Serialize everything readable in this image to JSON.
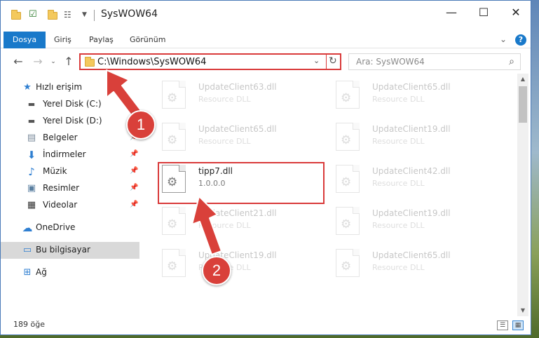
{
  "window": {
    "title": "SysWOW64",
    "controls": {
      "minimize": "—",
      "maximize": "☐",
      "close": "✕"
    }
  },
  "ribbon": {
    "tabs": [
      {
        "label": "Dosya",
        "active": true
      },
      {
        "label": "Giriş"
      },
      {
        "label": "Paylaş"
      },
      {
        "label": "Görünüm"
      }
    ],
    "expand_icon": "chevron-down-icon",
    "help": "?"
  },
  "address_bar": {
    "path": "C:\\Windows\\SysWOW64",
    "search_placeholder": "Ara: SysWOW64"
  },
  "sidebar": {
    "items": [
      {
        "label": "Hızlı erişim",
        "icon": "star-icon"
      },
      {
        "label": "Yerel Disk (C:)",
        "icon": "drive-c-icon",
        "pinned": true
      },
      {
        "label": "Yerel Disk (D:)",
        "icon": "drive-d-icon",
        "pinned": true
      },
      {
        "label": "Belgeler",
        "icon": "documents-icon",
        "pinned": true
      },
      {
        "label": "İndirmeler",
        "icon": "downloads-icon",
        "pinned": true
      },
      {
        "label": "Müzik",
        "icon": "music-icon",
        "pinned": true
      },
      {
        "label": "Resimler",
        "icon": "pictures-icon",
        "pinned": true
      },
      {
        "label": "Videolar",
        "icon": "videos-icon",
        "pinned": true
      },
      {
        "label": "OneDrive",
        "icon": "cloud-icon"
      },
      {
        "label": "Bu bilgisayar",
        "icon": "computer-icon",
        "selected": true
      },
      {
        "label": "Ağ",
        "icon": "network-icon"
      }
    ]
  },
  "files": [
    {
      "name": "UpdateClient63.dll",
      "desc": "Resource DLL",
      "faded": true
    },
    {
      "name": "UpdateClient65.dll",
      "desc": "Resource DLL",
      "faded": true
    },
    {
      "name": "UpdateClient65.dll",
      "desc": "Resource DLL",
      "faded": true
    },
    {
      "name": "UpdateClient19.dll",
      "desc": "Resource DLL",
      "faded": true
    },
    {
      "name": "tipp7.dll",
      "desc": "1.0.0.0",
      "faded": false
    },
    {
      "name": "UpdateClient42.dll",
      "desc": "Resource DLL",
      "faded": true
    },
    {
      "name": "UpdateClient21.dll",
      "desc": "Resource DLL",
      "faded": true
    },
    {
      "name": "UpdateClient19.dll",
      "desc": "Resource DLL",
      "faded": true
    },
    {
      "name": "UpdateClient19.dll",
      "desc": "Resource DLL",
      "faded": true
    },
    {
      "name": "UpdateClient65.dll",
      "desc": "Resource DLL",
      "faded": true
    }
  ],
  "status": {
    "item_count": "189 öğe"
  },
  "annotations": {
    "step1": "1",
    "step2": "2",
    "color": "#d9403a"
  }
}
